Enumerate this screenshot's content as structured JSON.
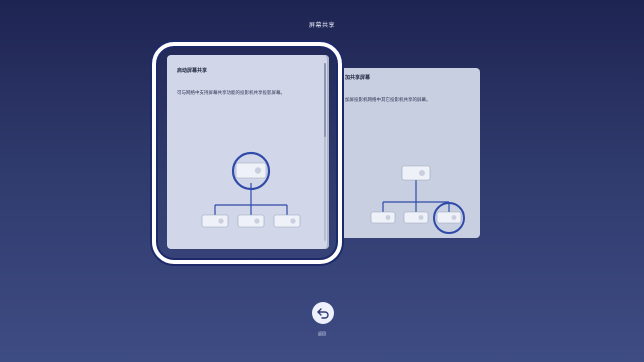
{
  "page": {
    "title": "屏幕共享"
  },
  "cards": [
    {
      "title": "启动屏幕共享",
      "description": "可与网络中支持屏幕共享功能的投影机共享投影屏幕。",
      "selected": true
    },
    {
      "title": "加共享屏幕",
      "description": "加屏投影机网络中其它投影机共享的屏幕。",
      "selected": false
    }
  ],
  "footer": {
    "back_label": "返回",
    "back_icon": "back-arrow-icon"
  },
  "colors": {
    "accent": "#2f4aa8",
    "card_bg": "#d1d7e8",
    "projector": "#eef1f7",
    "selection_border": "#ffffff"
  }
}
